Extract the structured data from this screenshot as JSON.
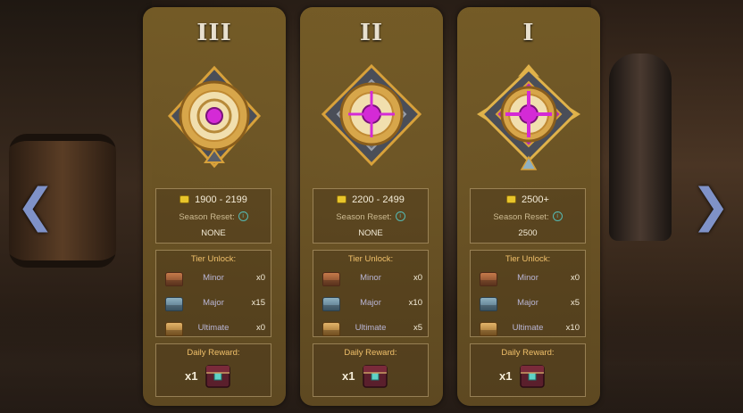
{
  "navigation": {
    "prev_icon": "chevron-left-icon",
    "next_icon": "chevron-right-icon"
  },
  "labels": {
    "season_reset": "Season Reset:",
    "tier_unlock": "Tier Unlock:",
    "daily_reward": "Daily Reward:"
  },
  "tiers": [
    {
      "numeral": "III",
      "rating_range": "1900 - 2199",
      "season_reset": "NONE",
      "unlock": [
        {
          "name": "Minor",
          "count": "x0"
        },
        {
          "name": "Major",
          "count": "x15"
        },
        {
          "name": "Ultimate",
          "count": "x0"
        }
      ],
      "daily_quantity": "x1"
    },
    {
      "numeral": "II",
      "rating_range": "2200 - 2499",
      "season_reset": "NONE",
      "unlock": [
        {
          "name": "Minor",
          "count": "x0"
        },
        {
          "name": "Major",
          "count": "x10"
        },
        {
          "name": "Ultimate",
          "count": "x5"
        }
      ],
      "daily_quantity": "x1"
    },
    {
      "numeral": "I",
      "rating_range": "2500+",
      "season_reset": "2500",
      "unlock": [
        {
          "name": "Minor",
          "count": "x0"
        },
        {
          "name": "Major",
          "count": "x5"
        },
        {
          "name": "Ultimate",
          "count": "x10"
        }
      ],
      "daily_quantity": "x1"
    }
  ],
  "colors": {
    "card": "#7a6028",
    "accent_gold": "#f0c06a",
    "emblem_magenta": "#d42ad6"
  }
}
